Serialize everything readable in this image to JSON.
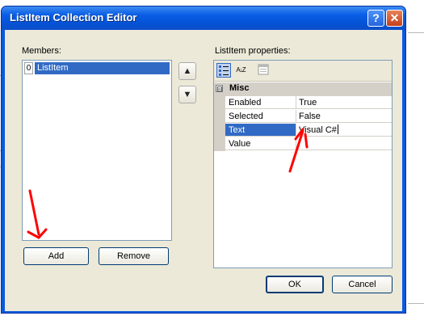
{
  "window": {
    "title": "ListItem Collection Editor",
    "help_glyph": "?",
    "close_glyph": "✕"
  },
  "members": {
    "label": "Members:",
    "items": [
      {
        "index": "0",
        "text": "ListItem"
      }
    ],
    "move_up_glyph": "▲",
    "move_down_glyph": "▼",
    "add_label": "Add",
    "remove_label": "Remove"
  },
  "properties": {
    "label": "ListItem properties:",
    "toolbar": {
      "categorized_icon": "categorized-icon",
      "alphabetical_icon": "alphabetical-icon",
      "alphabetical_glyph": "A↓Z",
      "pages_icon": "property-pages-icon"
    },
    "category": {
      "expander": "⊟",
      "name": "Misc"
    },
    "rows": [
      {
        "name": "Enabled",
        "value": "True"
      },
      {
        "name": "Selected",
        "value": "False"
      },
      {
        "name": "Text",
        "value": "Visual C#"
      },
      {
        "name": "Value",
        "value": ""
      }
    ],
    "selected_row": "Text"
  },
  "footer": {
    "ok_label": "OK",
    "cancel_label": "Cancel"
  },
  "colors": {
    "title_bar": "#0a5adf",
    "dialog_face": "#ece9d8",
    "selection": "#316ac5",
    "annotation_red": "#ff0000"
  }
}
